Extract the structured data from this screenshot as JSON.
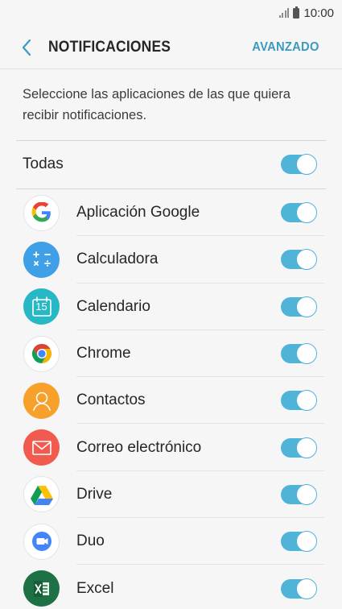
{
  "status_bar": {
    "time": "10:00"
  },
  "header": {
    "title": "NOTIFICACIONES",
    "action": "AVANZADO"
  },
  "description": "Seleccione las aplicaciones de las que quiera recibir notificaciones.",
  "all": {
    "label": "Todas",
    "enabled": true
  },
  "apps": [
    {
      "name": "Aplicación Google",
      "icon": "google-icon",
      "enabled": true
    },
    {
      "name": "Calculadora",
      "icon": "calculator-icon",
      "enabled": true
    },
    {
      "name": "Calendario",
      "icon": "calendar-icon",
      "date": "15",
      "enabled": true
    },
    {
      "name": "Chrome",
      "icon": "chrome-icon",
      "enabled": true
    },
    {
      "name": "Contactos",
      "icon": "contacts-icon",
      "enabled": true
    },
    {
      "name": "Correo electrónico",
      "icon": "email-icon",
      "enabled": true
    },
    {
      "name": "Drive",
      "icon": "drive-icon",
      "enabled": true
    },
    {
      "name": "Duo",
      "icon": "duo-icon",
      "enabled": true
    },
    {
      "name": "Excel",
      "icon": "excel-icon",
      "enabled": true
    }
  ],
  "colors": {
    "accent": "#4fb4d8",
    "link": "#3a9ac0",
    "background": "#f6f6f6"
  }
}
